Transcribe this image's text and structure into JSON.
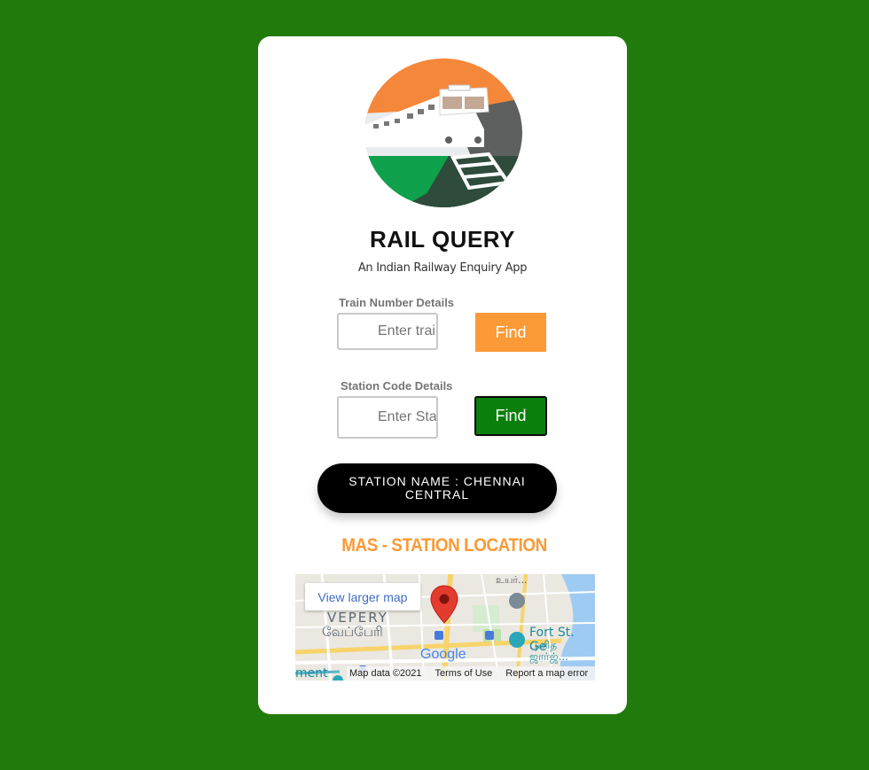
{
  "app": {
    "title": "RAIL QUERY",
    "subtitle": "An Indian Railway Enquiry App"
  },
  "train_search": {
    "label": "Train Number Details",
    "placeholder": "Enter train",
    "button_label": "Find"
  },
  "station_search": {
    "label": "Station Code Details",
    "placeholder": "Enter Stati",
    "button_label": "Find"
  },
  "result": {
    "station_name_text": "STATION NAME : CHENNAI CENTRAL"
  },
  "location": {
    "heading": "MAS - STATION LOCATION"
  },
  "map": {
    "larger_map_label": "View larger map",
    "data_credit": "Map data ©2021",
    "terms_label": "Terms of Use",
    "report_label": "Report a map error",
    "labels": {
      "vepery": "VEPERY",
      "vepery_tamil": "வேப்பேரி",
      "fort": "Fort St. Ge",
      "fort_tamil_1": "புனித",
      "fort_tamil_2": "ஜார்ஜ்...",
      "top_tamil": "உயர்...",
      "ment": "ment",
      "google": "Google"
    }
  },
  "colors": {
    "background": "#217a0c",
    "card": "#ffffff",
    "accent_orange": "#fb9a37",
    "find_green": "#0b7f0b",
    "pill": "#000000"
  },
  "icons": {
    "logo": "train-logo-icon",
    "map_pin": "map-pin-icon"
  }
}
